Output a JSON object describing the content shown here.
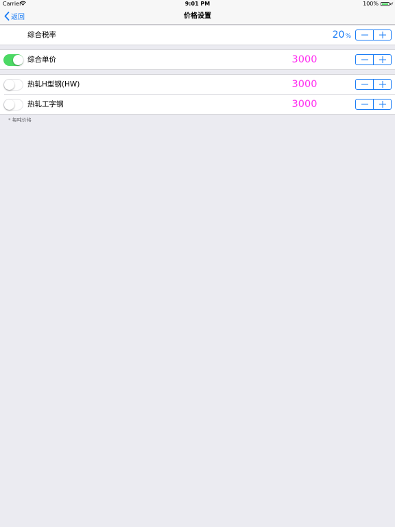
{
  "status_bar": {
    "carrier": "Carrier",
    "time": "9:01 PM",
    "battery_percent": "100%"
  },
  "nav": {
    "back_label": "返回",
    "title": "价格设置"
  },
  "tax": {
    "label": "综合税率",
    "value": "20",
    "unit": "%"
  },
  "unit_price": {
    "label": "综合单价",
    "value": "3000",
    "toggle_on": true
  },
  "items": [
    {
      "label": "热轧H型钢(HW)",
      "value": "3000",
      "toggle_on": false
    },
    {
      "label": "热轧工字钢",
      "value": "3000",
      "toggle_on": false
    }
  ],
  "footnote": "* 每吨价格",
  "colors": {
    "accent": "#1a7cf5",
    "price": "#ff2df0",
    "toggle_on": "#4cd964",
    "background": "#ebebf1"
  }
}
